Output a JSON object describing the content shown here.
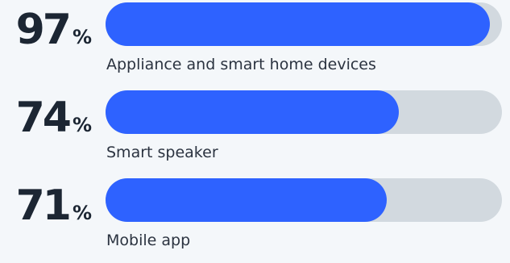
{
  "chart_data": {
    "type": "bar",
    "orientation": "horizontal",
    "categories": [
      "Appliance and smart home devices",
      "Smart speaker",
      "Mobile app"
    ],
    "values": [
      97,
      74,
      71
    ],
    "value_labels": [
      "97",
      "74",
      "71"
    ],
    "unit": "%",
    "xlim": [
      0,
      100
    ],
    "title": "",
    "xlabel": "",
    "ylabel": "",
    "grid": false,
    "legend": "none"
  },
  "colors": {
    "bar_fill": "#2e62ff",
    "bar_track": "#d2d9df",
    "value_text": "#1c2633",
    "label_text": "#2b3340",
    "background": "#f4f7fa"
  }
}
